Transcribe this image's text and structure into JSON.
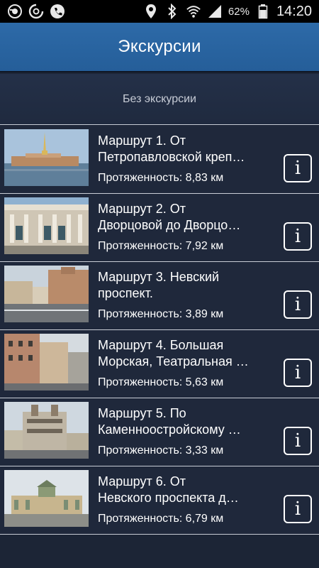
{
  "status_bar": {
    "battery_percent": "62%",
    "time": "14:20",
    "icons_left": [
      "sync-icon",
      "data-saver-icon",
      "phone-icon"
    ],
    "icons_right": [
      "location-icon",
      "bluetooth-icon",
      "wifi-icon",
      "signal-icon",
      "battery-icon"
    ]
  },
  "header": {
    "title": "Экскурсии"
  },
  "no_tour": {
    "label": "Без экскурсии"
  },
  "routes": [
    {
      "title_line1": "Маршрут 1. От",
      "title_line2": "Петропавловской креп…",
      "length": "Протяженность: 8,83 км",
      "image": "peter-paul-fortress"
    },
    {
      "title_line1": "Маршрут 2. От",
      "title_line2": "Дворцовой до Дворцо…",
      "length": "Протяженность: 7,92 км",
      "image": "palace-facade"
    },
    {
      "title_line1": "Маршрут 3. Невский",
      "title_line2": "проспект.",
      "length": "Протяженность: 3,89 км",
      "image": "nevsky-street"
    },
    {
      "title_line1": "Маршрут 4. Большая",
      "title_line2": "Морская, Театральная …",
      "length": "Протяженность: 5,63 км",
      "image": "bolshaya-morskaya-street"
    },
    {
      "title_line1": "Маршрут 5. По",
      "title_line2": "Каменноостройскому …",
      "length": "Протяженность: 3,33 км",
      "image": "kamennoostrovsky-building"
    },
    {
      "title_line1": "Маршрут 6. От",
      "title_line2": "Невского проспекта д…",
      "length": "Протяженность: 6,79 км",
      "image": "pavilion-building"
    }
  ],
  "colors": {
    "header_bg": "#2a65a3",
    "list_bg": "#1f283b",
    "divider": "#c8cdd6"
  }
}
